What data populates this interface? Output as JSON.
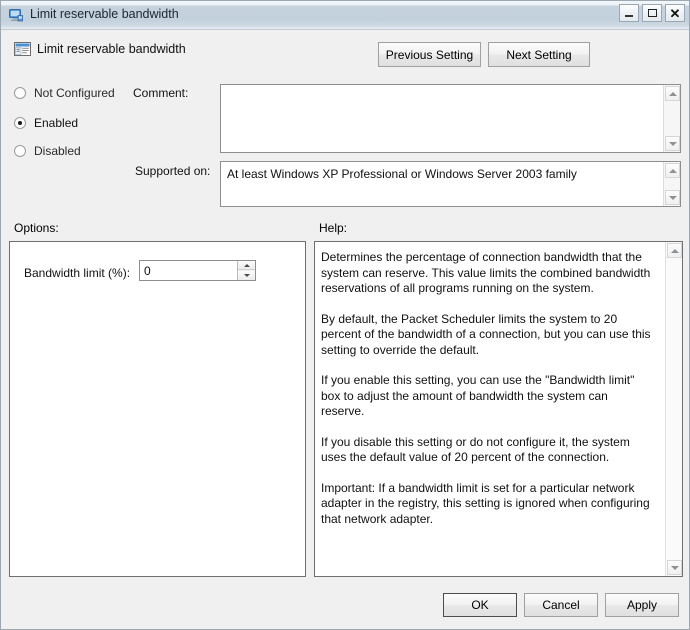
{
  "window": {
    "title": "Limit reservable bandwidth",
    "title_icon": "computer-monitor-icon",
    "controls": {
      "minimize": "minimize-icon",
      "maximize": "maximize-icon",
      "close": "✕"
    }
  },
  "header": {
    "icon": "policy-setting-icon",
    "setting_title": "Limit reservable bandwidth",
    "previous_label": "Previous Setting",
    "next_label": "Next Setting"
  },
  "state": {
    "options": [
      {
        "label": "Not Configured",
        "selected": false
      },
      {
        "label": "Enabled",
        "selected": true
      },
      {
        "label": "Disabled",
        "selected": false
      }
    ]
  },
  "comment": {
    "label": "Comment:",
    "value": ""
  },
  "supported": {
    "label": "Supported on:",
    "value": "At least Windows XP Professional or Windows Server 2003 family"
  },
  "options_section": {
    "label": "Options:",
    "bandwidth_label": "Bandwidth limit (%):",
    "bandwidth_value": "0"
  },
  "help_section": {
    "label": "Help:",
    "paragraphs": [
      "Determines the percentage of connection bandwidth that the system can reserve. This value limits the combined bandwidth reservations of all programs running on the system.",
      "By default, the Packet Scheduler limits the system to 20 percent of the bandwidth of a connection, but you can use this setting to override the default.",
      "If you enable this setting, you can use the \"Bandwidth limit\" box to adjust the amount of bandwidth the system can reserve.",
      "If you disable this setting or do not configure it, the system uses the default value of 20 percent of the connection.",
      "Important: If a bandwidth limit is set for a particular network adapter in the registry, this setting is ignored when configuring that network adapter."
    ]
  },
  "footer": {
    "ok_label": "OK",
    "cancel_label": "Cancel",
    "apply_label": "Apply"
  }
}
